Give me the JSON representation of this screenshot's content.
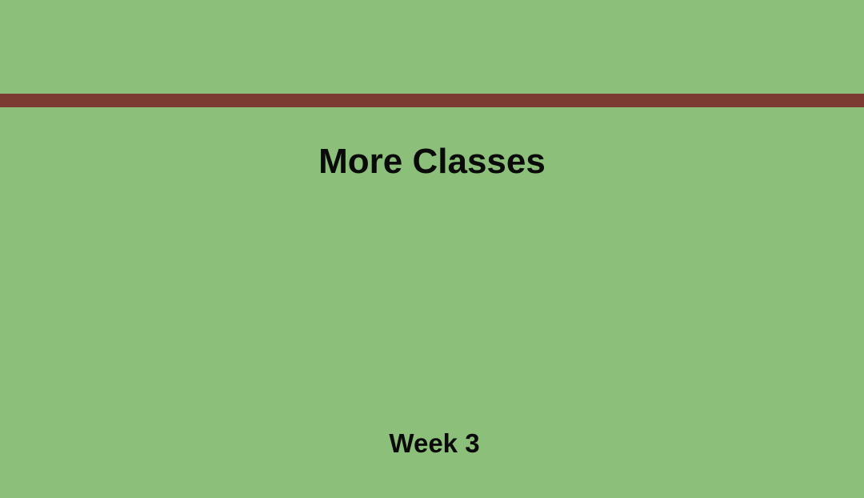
{
  "slide": {
    "title": "More Classes",
    "subtitle": "Week 3"
  },
  "colors": {
    "background": "#8cbf79",
    "rule": "#7c3b32",
    "text": "#0a0a0a"
  }
}
